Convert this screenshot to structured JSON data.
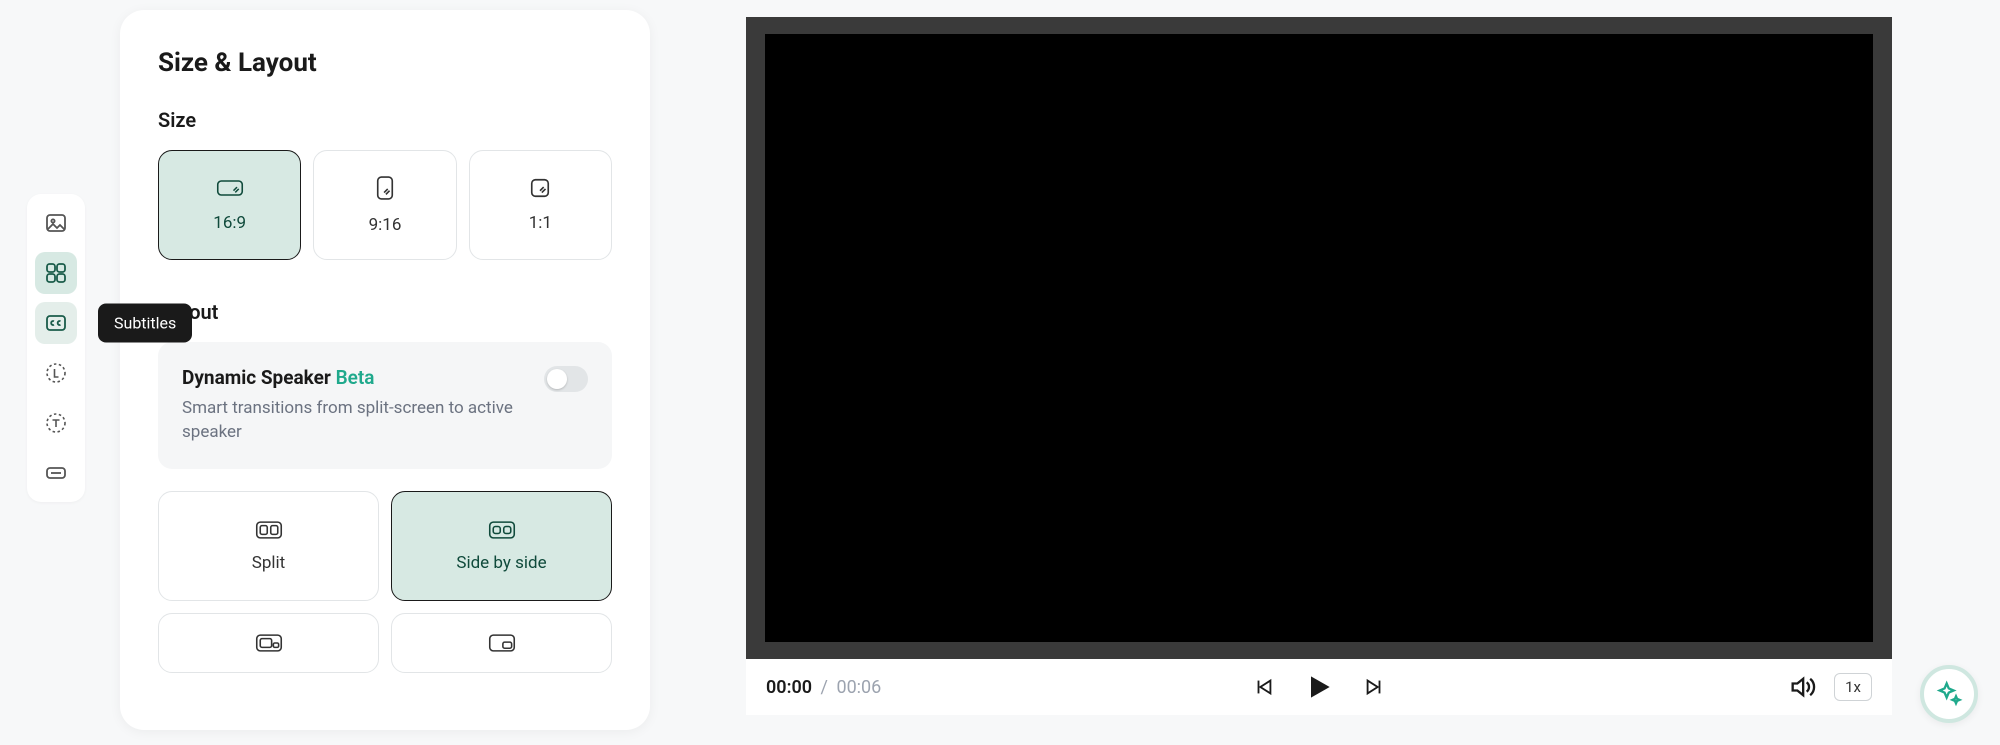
{
  "rail": {
    "tooltip_subtitles": "Subtitles"
  },
  "panel": {
    "title": "Size & Layout",
    "size_label": "Size",
    "sizes": {
      "s16_9": "16:9",
      "s9_16": "9:16",
      "s1_1": "1:1"
    },
    "layout_label": "Layout",
    "dynamic": {
      "title": "Dynamic Speaker",
      "beta": "Beta",
      "desc": "Smart transitions from split-screen to active speaker"
    },
    "layouts": {
      "split": "Split",
      "side_by_side": "Side by side"
    }
  },
  "player": {
    "current": "00:00",
    "sep": "/",
    "total": "00:06",
    "speed": "1x"
  }
}
